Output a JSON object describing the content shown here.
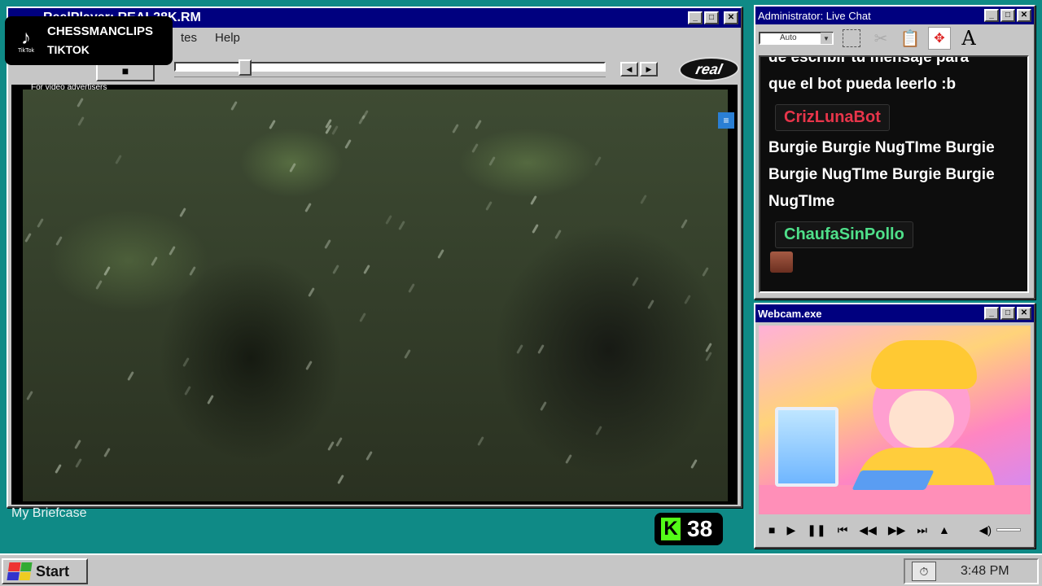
{
  "realplayer": {
    "title": "RealPlayer: REAL28K.RM",
    "menu": {
      "item_partial": "tes",
      "help": "Help"
    },
    "ad_text": "For video advertisers",
    "logo_text": "real",
    "seek_position": 0.15
  },
  "tiktok": {
    "line1": "CHESSMANCLIPS",
    "line2": "TIKTOK",
    "icon_label": "TikTok"
  },
  "chat": {
    "title": "Administrator: Live Chat",
    "font_select": "Auto",
    "messages": [
      {
        "type": "text",
        "text": "de escribir tu mensaje para",
        "cut": true
      },
      {
        "type": "text",
        "text": "que el bot pueda leerlo :b"
      },
      {
        "type": "user",
        "name": "CrizLunaBot",
        "color": "#e8354a"
      },
      {
        "type": "text",
        "text": "Burgie Burgie NugTIme Burgie Burgie NugTIme Burgie Burgie NugTIme"
      },
      {
        "type": "user",
        "name": "ChaufaSinPollo",
        "color": "#4fe08a"
      }
    ],
    "toolbar_icons": [
      "select-icon",
      "cut-icon",
      "paste-icon",
      "move-icon",
      "text-icon"
    ]
  },
  "webcam": {
    "title": "Webcam.exe"
  },
  "desktop": {
    "briefcase_label": "My Briefcase"
  },
  "kick": {
    "letter": "K",
    "count": "38"
  },
  "taskbar": {
    "start_label": "Start",
    "clock": "3:48 PM"
  }
}
